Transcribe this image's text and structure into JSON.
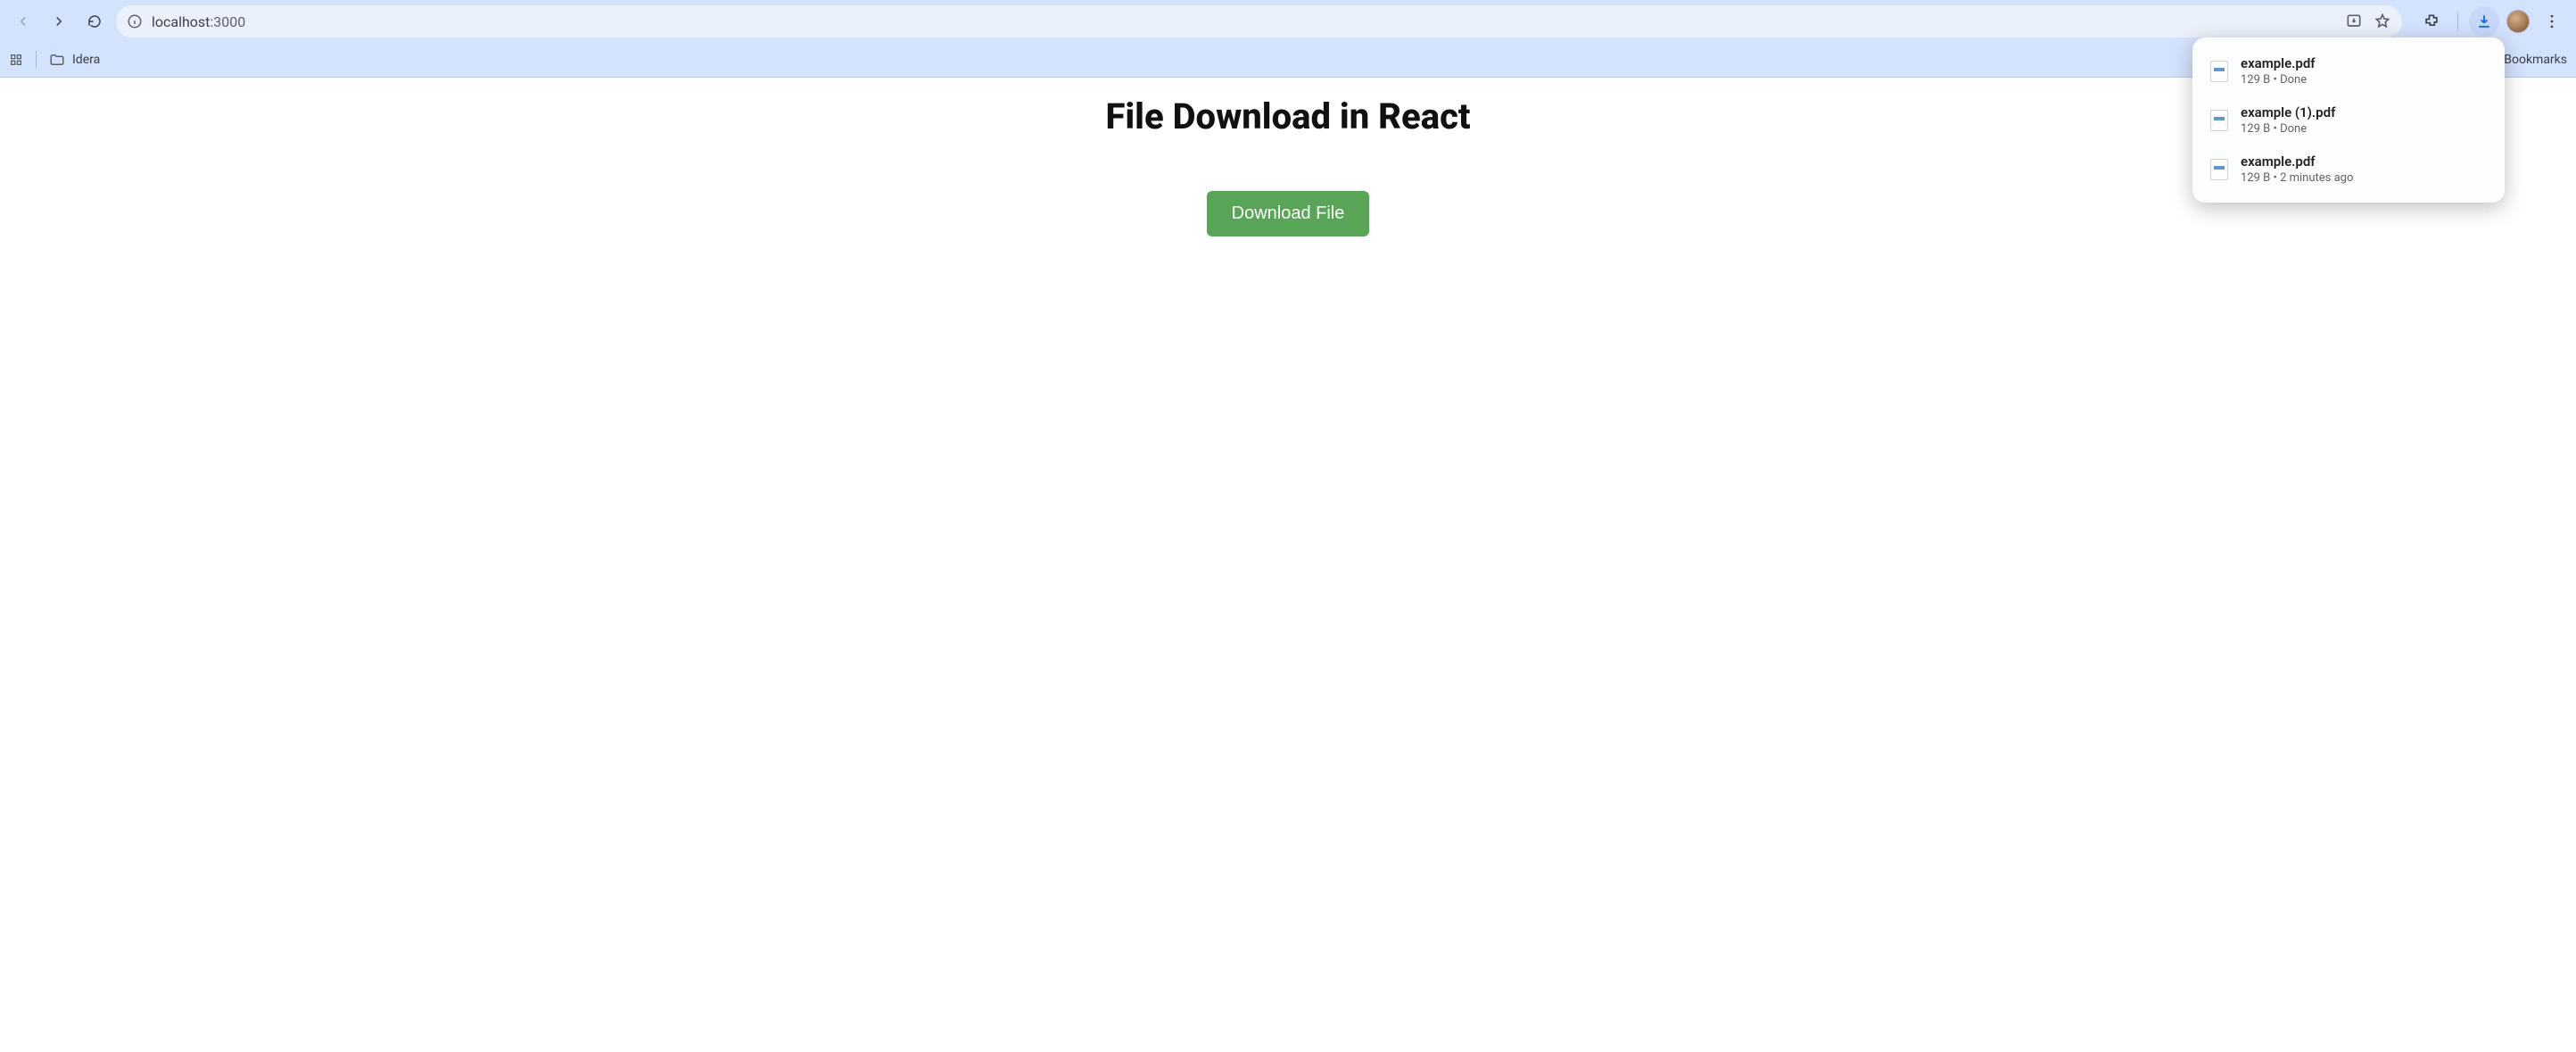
{
  "browser": {
    "url_host": "localhost",
    "url_port": ":3000",
    "bookmarks_label": "Bookmarks",
    "bookmarks": {
      "folder1": "Idera"
    }
  },
  "downloads": [
    {
      "name": "example.pdf",
      "size": "129 B",
      "status": "Done"
    },
    {
      "name": "example (1).pdf",
      "size": "129 B",
      "status": "Done"
    },
    {
      "name": "example.pdf",
      "size": "129 B",
      "status": "2 minutes ago"
    }
  ],
  "page": {
    "heading": "File Download in React",
    "button_label": "Download File"
  }
}
